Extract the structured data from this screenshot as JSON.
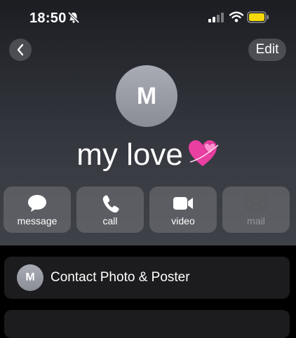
{
  "status_bar": {
    "time": "18:50"
  },
  "nav": {
    "edit_label": "Edit"
  },
  "contact": {
    "initial": "M",
    "name": "my love",
    "emoji": "💞"
  },
  "actions": [
    {
      "label": "message",
      "icon": "message-bubble-icon",
      "enabled": true
    },
    {
      "label": "call",
      "icon": "phone-icon",
      "enabled": true
    },
    {
      "label": "video",
      "icon": "video-camera-icon",
      "enabled": true
    },
    {
      "label": "mail",
      "icon": "envelope-icon",
      "enabled": false
    }
  ],
  "rows": [
    {
      "initial": "M",
      "label": "Contact Photo & Poster"
    }
  ],
  "colors": {
    "battery": "#f5d90a",
    "card_bg": "#1c1c1e",
    "disabled_text": "#5a5a5e"
  }
}
